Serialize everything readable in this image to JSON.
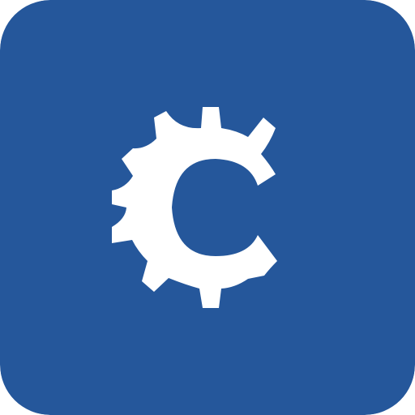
{
  "app_icon": {
    "icon_name": "gear-c-logo-icon",
    "colors": {
      "background": "#25579b",
      "glyph": "#ffffff"
    }
  }
}
